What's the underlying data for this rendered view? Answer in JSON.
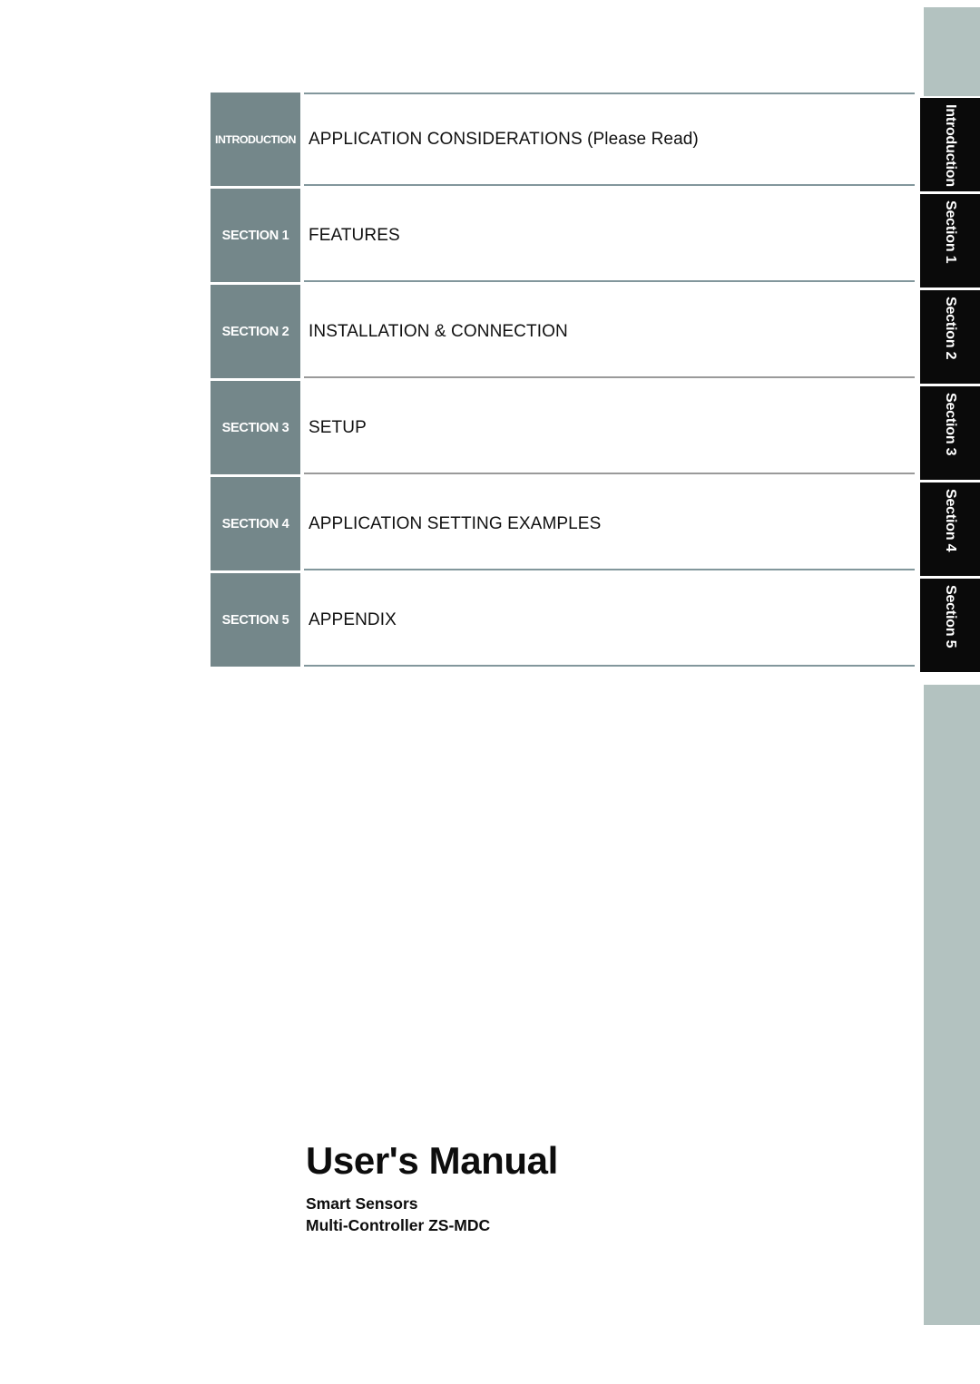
{
  "document": {
    "cover": {
      "title": "User's Manual",
      "subtitle_line1": "Smart Sensors",
      "subtitle_line2": "Multi-Controller ZS-MDC"
    },
    "colors": {
      "badge_gray": "#74878a",
      "edge_band": "#b3c2c0",
      "tab_black": "#0a0a0a",
      "rule_blue_gray": "#82979c",
      "rule_gray": "#9a9a9a",
      "text": "#101010"
    }
  },
  "toc": {
    "rows": [
      {
        "badge": "INTRODUCTION",
        "title": "APPLICATION CONSIDERATIONS (Please Read)",
        "rule_top": "blue",
        "rule_bottom": "blue"
      },
      {
        "badge": "SECTION 1",
        "title": "FEATURES",
        "rule_top": "blue",
        "rule_bottom": "blue"
      },
      {
        "badge": "SECTION 2",
        "title": "INSTALLATION & CONNECTION",
        "rule_top": "blue",
        "rule_bottom": "gray"
      },
      {
        "badge": "SECTION 3",
        "title": "SETUP",
        "rule_top": "gray",
        "rule_bottom": "gray"
      },
      {
        "badge": "SECTION 4",
        "title": "APPLICATION SETTING EXAMPLES",
        "rule_top": "gray",
        "rule_bottom": "blue"
      },
      {
        "badge": "SECTION 5",
        "title": "APPENDIX",
        "rule_top": "blue",
        "rule_bottom": "blue"
      }
    ]
  },
  "edge_tabs": {
    "labels": [
      "Introduction",
      "Section 1",
      "Section 2",
      "Section 3",
      "Section 4",
      "Section 5"
    ]
  }
}
